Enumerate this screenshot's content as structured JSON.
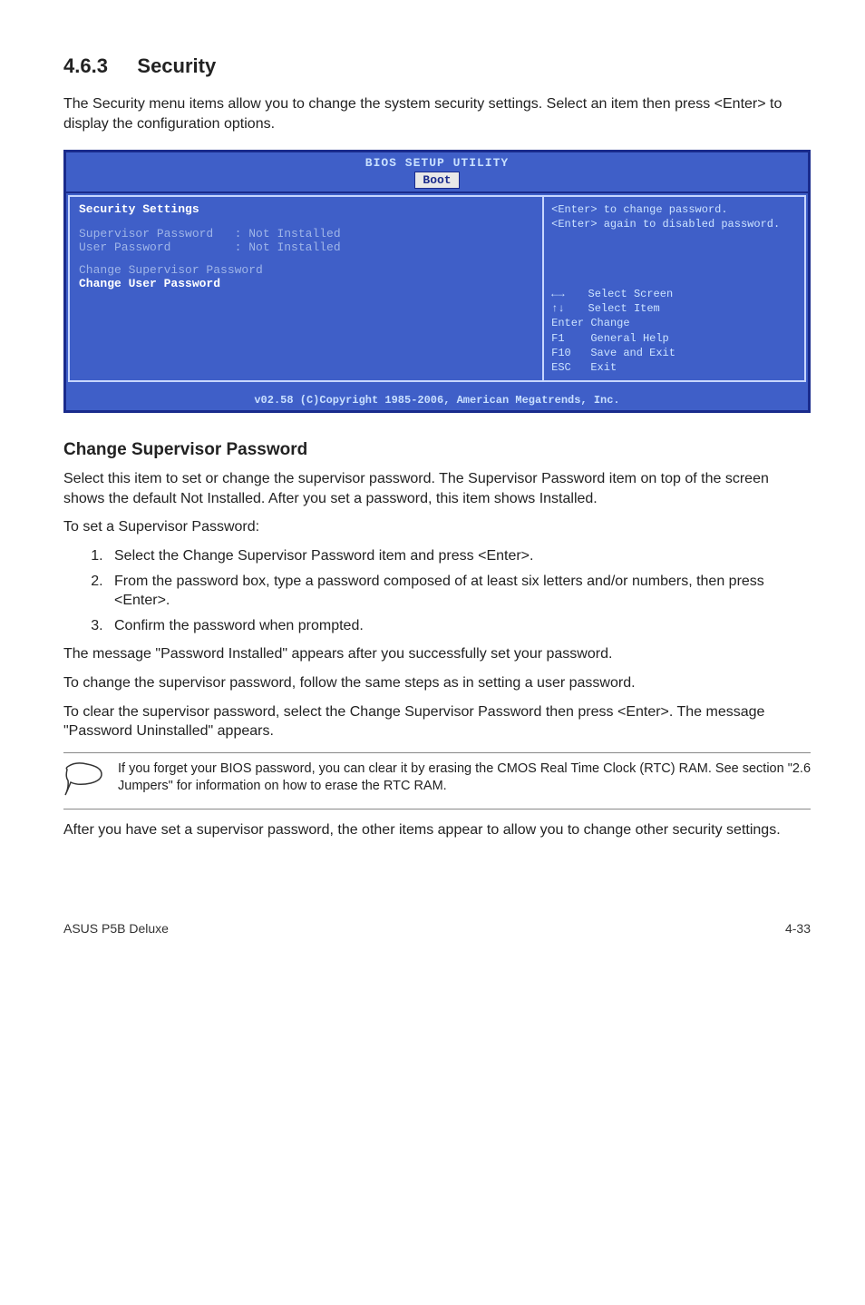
{
  "section": {
    "number": "4.6.3",
    "title": "Security"
  },
  "lead": "The Security menu items allow you to change the system security settings. Select an item then press <Enter> to display the configuration options.",
  "bios": {
    "title": "BIOS SETUP UTILITY",
    "tab": "Boot",
    "heading": "Security Settings",
    "sup_label": "Supervisor Password",
    "sup_value": ": Not Installed",
    "user_label": "User Password",
    "user_value": ": Not Installed",
    "change_sup": "Change Supervisor Password",
    "change_user": "Change User Password",
    "help_top": "<Enter> to change password.\n<Enter> again to disabled password.",
    "help_keys": {
      "lr": "Select Screen",
      "ud": "Select Item",
      "enter_k": "Enter",
      "enter": "Change",
      "f1_k": "F1",
      "f1": "General Help",
      "f10_k": "F10",
      "f10": "Save and Exit",
      "esc_k": "ESC",
      "esc": "Exit"
    },
    "footer": "v02.58 (C)Copyright 1985-2006, American Megatrends, Inc."
  },
  "csp_heading": "Change Supervisor Password",
  "csp_p1": "Select this item to set or change the supervisor password. The Supervisor Password item on top of the screen shows the default Not Installed. After you set a password, this item shows Installed.",
  "csp_p2": "To set a Supervisor Password:",
  "steps": [
    "Select the Change Supervisor Password item and press <Enter>.",
    "From the password box, type a password composed of at least six letters and/or numbers, then press <Enter>.",
    "Confirm the password when prompted."
  ],
  "after_steps": "The message \"Password Installed\" appears after you successfully set your password.",
  "change_p": "To change the supervisor password, follow the same steps as in setting a user password.",
  "clear_p": "To clear the supervisor password, select the Change Supervisor Password then press <Enter>. The message \"Password Uninstalled\" appears.",
  "note": "If you forget your BIOS password, you can clear it by erasing the CMOS Real Time Clock (RTC) RAM. See section \"2.6 Jumpers\" for information on how to erase the RTC RAM.",
  "after_note": "After you have set a supervisor password, the other items appear to allow you to change other security settings.",
  "footer": {
    "left": "ASUS P5B Deluxe",
    "right": "4-33"
  }
}
